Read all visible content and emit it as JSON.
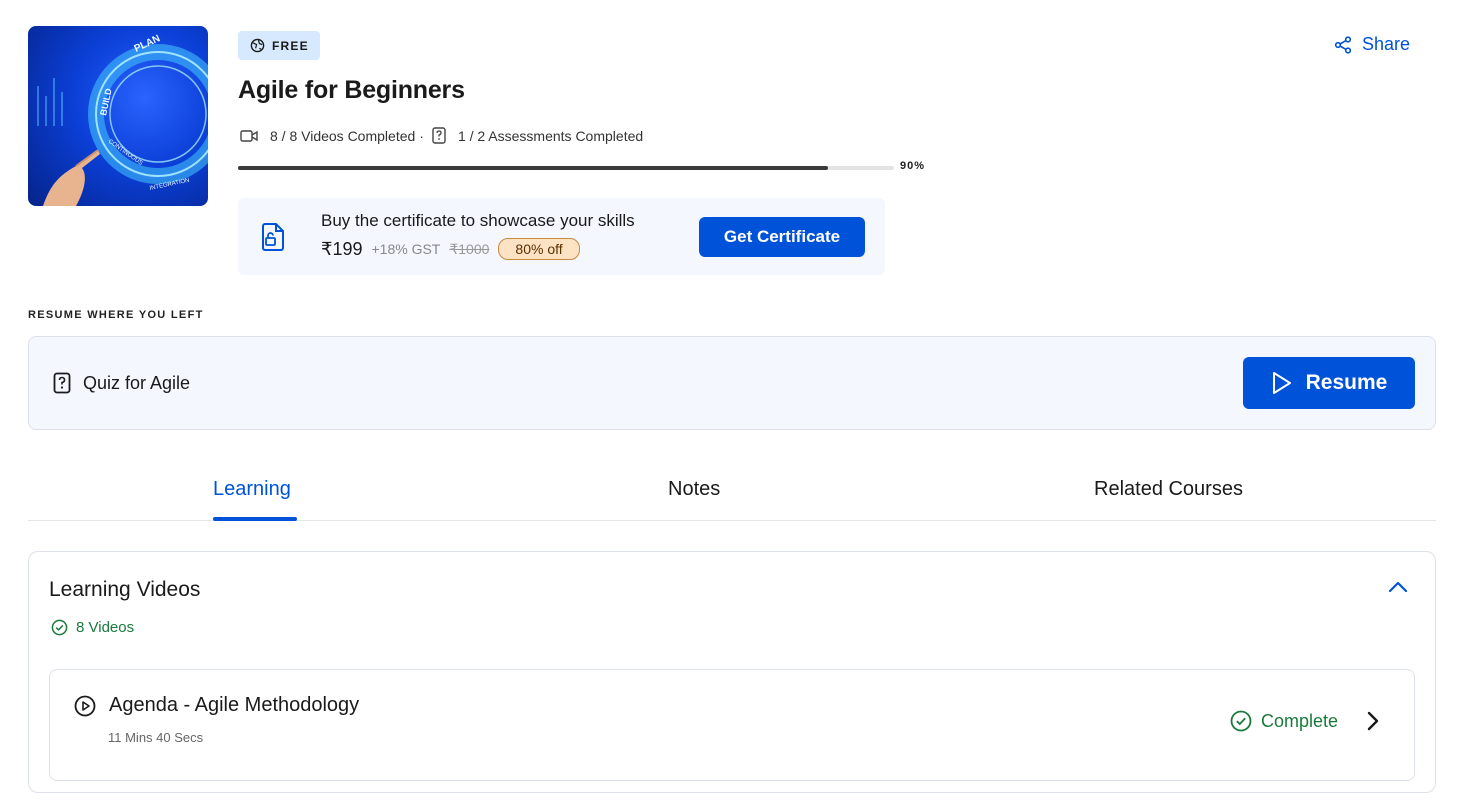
{
  "course": {
    "badge": "FREE",
    "title": "Agile for Beginners",
    "videos_completed": "8 / 8 Videos Completed",
    "separator": "·",
    "assessments_completed": "1 / 2 Assessments Completed",
    "progress_percent": 90,
    "progress_label": "90%",
    "thumbnail_words": [
      "PLAN",
      "BUILD",
      "CONTINUOUS",
      "INTEGRATION"
    ]
  },
  "header": {
    "share_label": "Share"
  },
  "certificate": {
    "text": "Buy the certificate to showcase your skills",
    "price": "₹199",
    "gst": "+18% GST",
    "original_price": "₹1000",
    "discount": "80% off",
    "button_label": "Get Certificate"
  },
  "resume": {
    "label": "RESUME WHERE YOU LEFT",
    "item_title": "Quiz for Agile",
    "button_label": "Resume"
  },
  "tabs": [
    {
      "label": "Learning",
      "active": true
    },
    {
      "label": "Notes",
      "active": false
    },
    {
      "label": "Related Courses",
      "active": false
    }
  ],
  "learning_videos": {
    "title": "Learning Videos",
    "count_label": "8 Videos",
    "items": [
      {
        "title": "Agenda - Agile Methodology",
        "duration": "11 Mins 40 Secs",
        "status": "Complete"
      }
    ]
  },
  "colors": {
    "accent": "#0052d9",
    "success": "#1a7a3c",
    "panel_bg": "#f5f7ff",
    "badge_bg": "#d6e9ff",
    "discount_bg": "#fde2c4"
  }
}
